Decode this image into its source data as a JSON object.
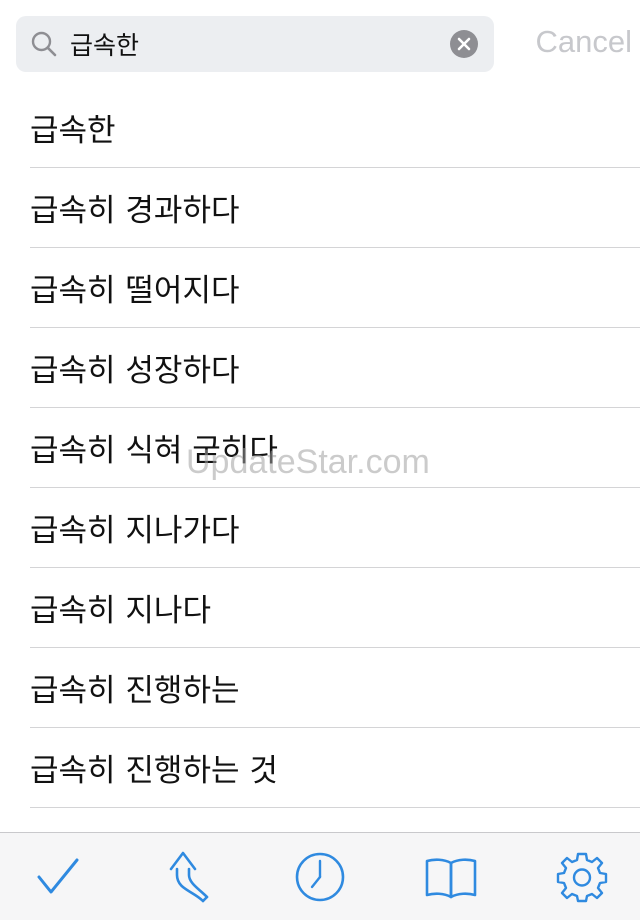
{
  "search": {
    "value": "급속한",
    "cancel_label": "Cancel"
  },
  "results": [
    "급속한",
    "급속히 경과하다",
    "급속히 떨어지다",
    "급속히 성장하다",
    "급속히 식혀 굳히다",
    "급속히 지나가다",
    "급속히 지나다",
    "급속히 진행하는",
    "급속히 진행하는 것",
    ""
  ],
  "watermark": "UpdateStar.com",
  "toolbar": {
    "items": [
      "checkmark-icon",
      "back-arrow-icon",
      "history-clock-icon",
      "book-icon",
      "settings-gear-icon"
    ]
  },
  "colors": {
    "accent": "#2f8ae0",
    "search_field_bg": "#eceef1",
    "cancel_text": "#c7c8cc",
    "separator": "#d4d4d6"
  }
}
